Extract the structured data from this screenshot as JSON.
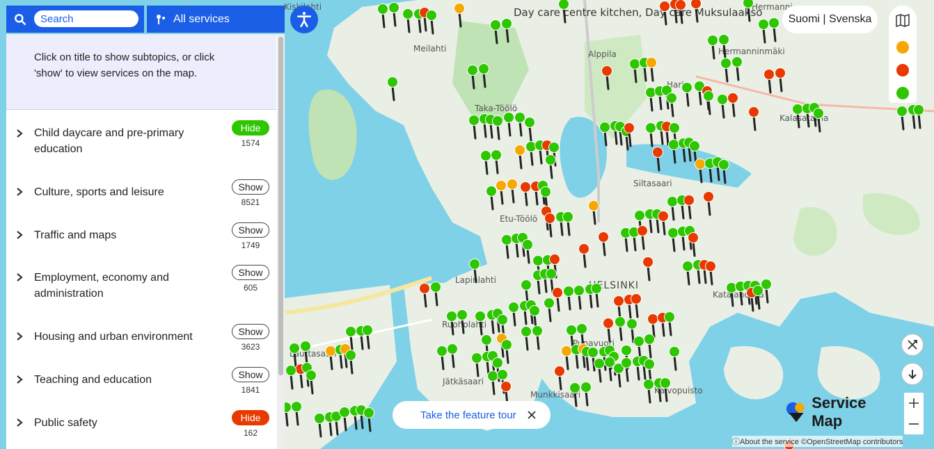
{
  "search": {
    "placeholder": "Search"
  },
  "services_button": {
    "label": "All services"
  },
  "panel": {
    "intro": "Click on title to show subtopics, or click 'show' to view services on the map.",
    "categories": [
      {
        "title": "Child daycare and pre-primary education",
        "toggle": "Hide",
        "count": "1574",
        "state": "hide-green"
      },
      {
        "title": "Culture, sports and leisure",
        "toggle": "Show",
        "count": "8521",
        "state": "show"
      },
      {
        "title": "Traffic and maps",
        "toggle": "Show",
        "count": "1749",
        "state": "show"
      },
      {
        "title": "Employment, economy and administration",
        "toggle": "Show",
        "count": "605",
        "state": "show"
      },
      {
        "title": "Housing and urban environment",
        "toggle": "Show",
        "count": "3623",
        "state": "show"
      },
      {
        "title": "Teaching and education",
        "toggle": "Show",
        "count": "1841",
        "state": "show"
      },
      {
        "title": "Public safety",
        "toggle": "Hide",
        "count": "162",
        "state": "hide-red"
      }
    ]
  },
  "language": {
    "label": "Suomi | Svenska"
  },
  "legend_colors": [
    "#f6a800",
    "#e73900",
    "#2dc600"
  ],
  "map": {
    "hover_label": "Day care centre kitchen, Day care Muksulaakso",
    "places": [
      "Meilahti",
      "Alppila",
      "Hermanninmäki",
      "Hermanni",
      "Harju",
      "Kalasatama",
      "Taka-Töölö",
      "Siltasaari",
      "Etu-Töölö",
      "Lapinlahti",
      "HELSINKI",
      "Katajanokka",
      "Ruoholahti",
      "Punavuori",
      "Jätkäsaari",
      "Munkkisaari",
      "Kaivopuisto",
      "Lauttasaari",
      "Kiskilahti"
    ]
  },
  "tour": {
    "label": "Take the feature tour"
  },
  "brand": {
    "name": "Service Map"
  },
  "attribution": {
    "about": "About the service",
    "osm": "©OpenStreetMap contributors"
  },
  "icons": [
    "search-icon",
    "services-icon",
    "accessibility-icon",
    "map-layers-icon",
    "measure-tool-icon",
    "locate-icon",
    "zoom-in-icon",
    "zoom-out-icon",
    "close-icon",
    "chevron-right-icon"
  ]
}
